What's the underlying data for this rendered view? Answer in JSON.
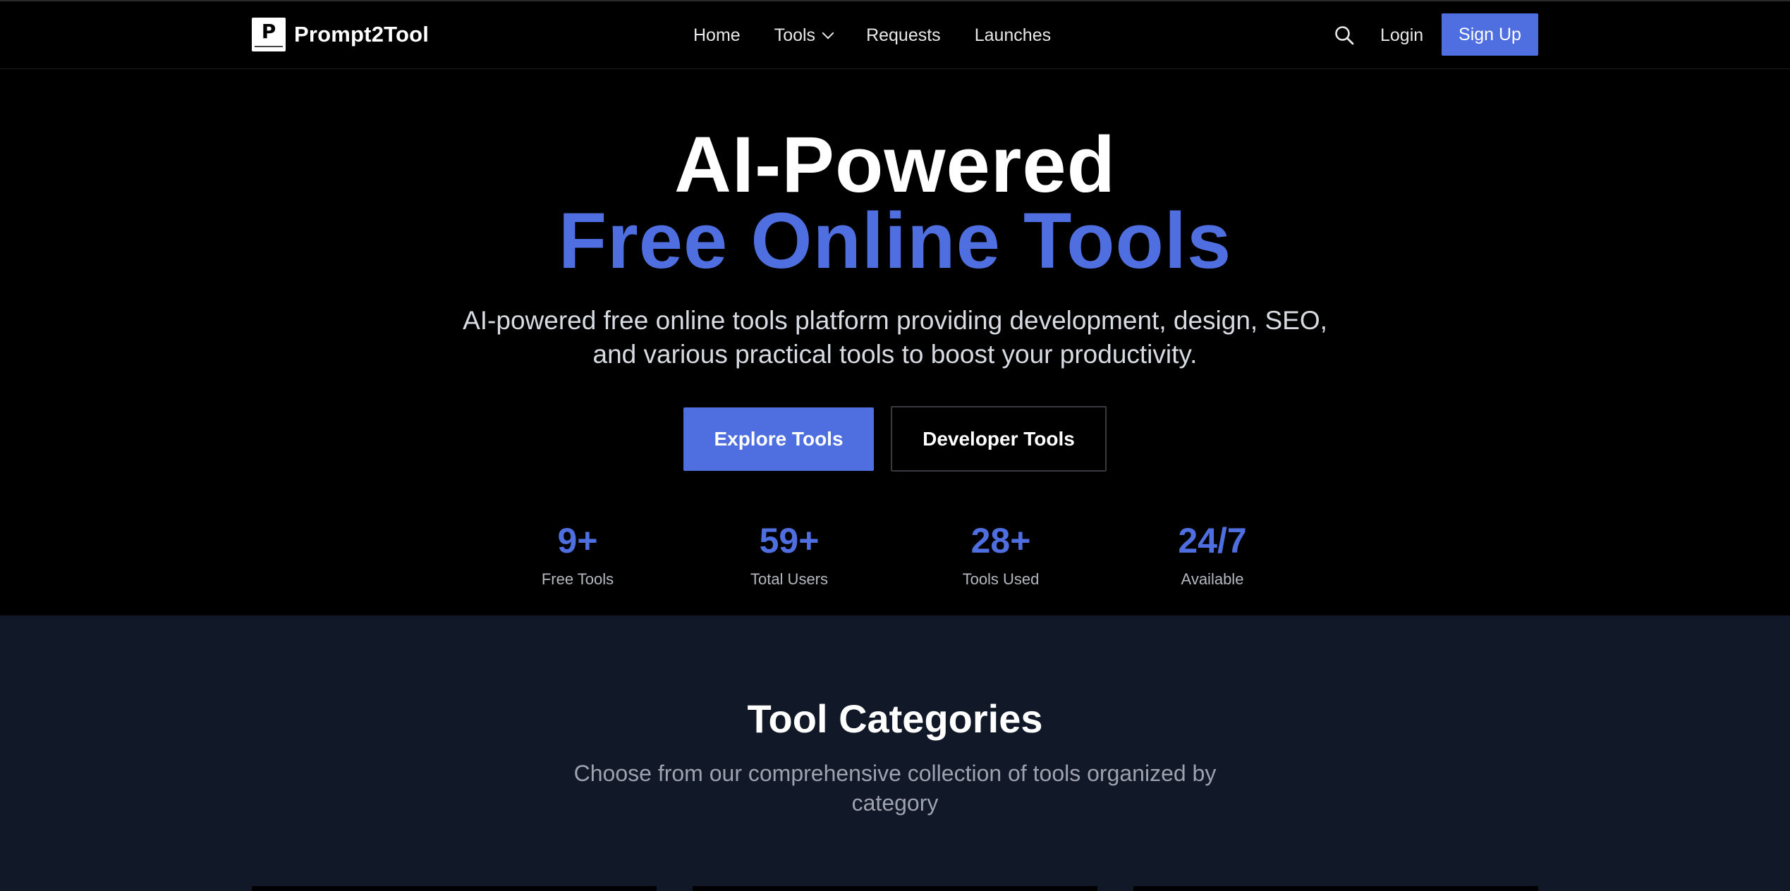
{
  "header": {
    "brand": "Prompt2Tool",
    "nav": [
      {
        "label": "Home"
      },
      {
        "label": "Tools",
        "has_dropdown": true
      },
      {
        "label": "Requests"
      },
      {
        "label": "Launches"
      }
    ],
    "search_icon": "search-icon",
    "login_label": "Login",
    "signup_label": "Sign Up"
  },
  "hero": {
    "title_line1": "AI-Powered",
    "title_line2": "Free Online Tools",
    "subtitle_line1": "AI-powered free online tools platform providing development, design, SEO,",
    "subtitle_line2": "and various practical tools to boost your productivity.",
    "primary_button": "Explore Tools",
    "secondary_button": "Developer Tools",
    "stats": [
      {
        "value": "9+",
        "label": "Free Tools"
      },
      {
        "value": "59+",
        "label": "Total Users"
      },
      {
        "value": "28+",
        "label": "Tools Used"
      },
      {
        "value": "24/7",
        "label": "Available"
      }
    ]
  },
  "categories": {
    "title": "Tool Categories",
    "subtitle_line1": "Choose from our comprehensive collection of tools organized by",
    "subtitle_line2": "category"
  },
  "colors": {
    "accent": "#4f6fe0",
    "background": "#000000",
    "section_background": "#111827"
  }
}
